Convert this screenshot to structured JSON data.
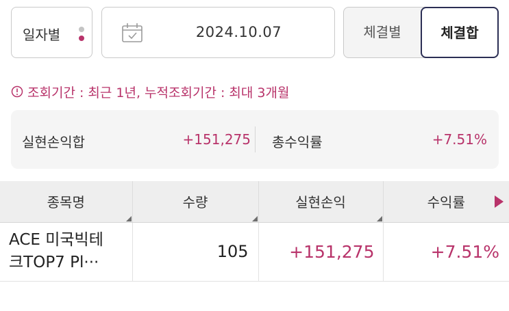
{
  "filters": {
    "period_label": "일자별",
    "date_value": "2024.10.07",
    "segment": [
      {
        "label": "체결별",
        "selected": false
      },
      {
        "label": "체결합",
        "selected": true
      }
    ]
  },
  "notice": "조회기간 : 최근 1년, 누적조회기간 : 최대 3개월",
  "summary": {
    "realized_pl_label": "실현손익합",
    "realized_pl_value": "+151,275",
    "total_return_label": "총수익률",
    "total_return_value": "+7.51%"
  },
  "table": {
    "headers": [
      "종목명",
      "수량",
      "실현손익",
      "수익률"
    ],
    "rows": [
      {
        "name_line1": "ACE 미국빅테",
        "name_line2": "크TOP7 Pl···",
        "qty": "105",
        "pl": "+151,275",
        "rate": "+7.51%"
      }
    ]
  },
  "colors": {
    "accent": "#b8336a",
    "navy_border": "#2b2e54",
    "panel_bg": "#f5f5f5",
    "header_bg": "#eeeeee"
  },
  "icons": {
    "calendar": "calendar-icon",
    "notice": "info-circle-icon",
    "scroll_right": "arrow-right-icon"
  }
}
